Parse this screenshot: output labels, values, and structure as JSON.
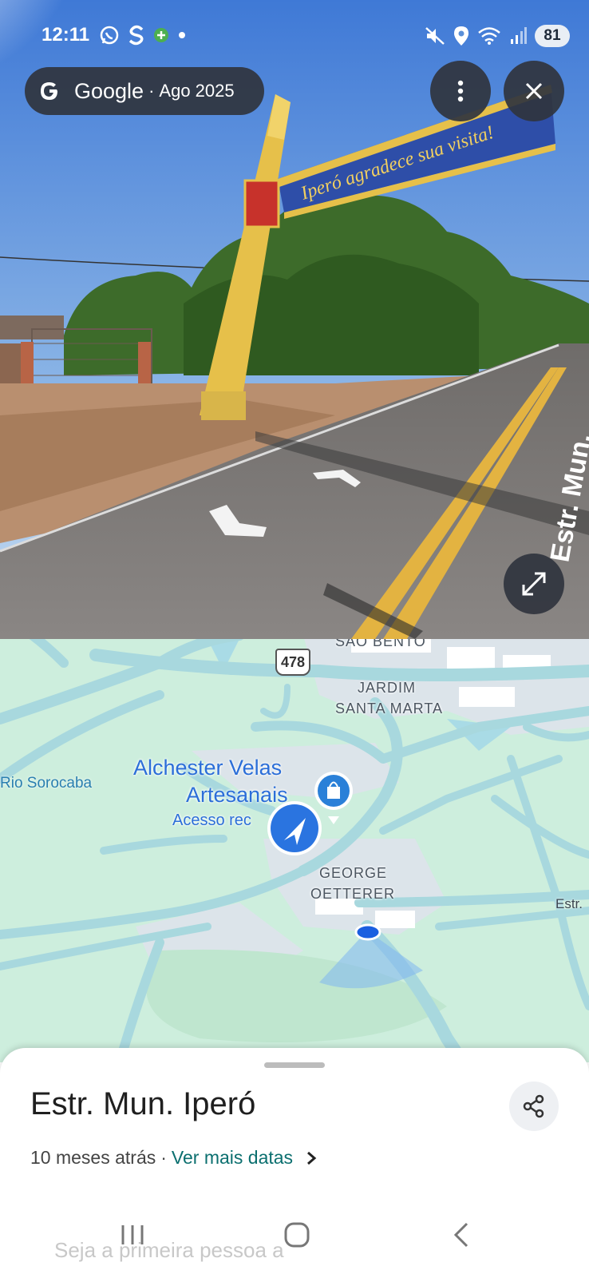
{
  "status_bar": {
    "time": "12:11",
    "left_icons": [
      "whatsapp-icon",
      "s-app-icon",
      "plus-app-icon",
      "dot-icon"
    ],
    "right_icons": [
      "mute-icon",
      "location-icon",
      "wifi-icon",
      "signal-icon"
    ],
    "battery": "81"
  },
  "streetview": {
    "brand": "Google",
    "separator": "·",
    "capture_date": "Ago 2025",
    "sign_text": "Iperó agradece sua visita!",
    "road_text": "Estr. Mun."
  },
  "map": {
    "highway_shield": "478",
    "labels": {
      "sao_bento": "SÃO BENTO",
      "jardim_line1": "JARDIM",
      "jardim_line2": "SANTA MARTA",
      "rio": "Rio Sorocaba",
      "poi_line1": "Alchester Velas",
      "poi_line2": "Artesanais",
      "poi_sub": "Acesso rec",
      "george_line1": "GEORGE",
      "george_line2": "OETTERER",
      "estr": "Estr."
    }
  },
  "sheet": {
    "title": "Estr. Mun. Iperó",
    "ago": "10 meses atrás",
    "dot": "·",
    "more_dates": "Ver mais datas",
    "first_person": "Seja a primeira pessoa a"
  },
  "colors": {
    "map_bg": "#cdeedd",
    "map_road": "#a8d8de",
    "accent_blue": "#2b6ed8",
    "teal_link": "#0b6f6f"
  }
}
